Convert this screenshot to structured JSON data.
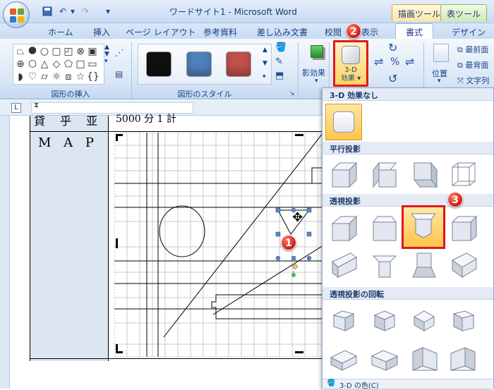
{
  "window": {
    "title": "ワードサイト1 - Microsoft Word",
    "context_tabs": [
      "描画ツール",
      "表ツール"
    ]
  },
  "tabs": [
    "ホーム",
    "挿入",
    "ページ レイアウト",
    "参考資料",
    "差し込み文書",
    "校閲",
    "表示",
    "書式",
    "デザイン"
  ],
  "active_tab": "書式",
  "ribbon": {
    "groups": {
      "insert_shapes": "図形の挿入",
      "shape_styles": "図形のスタイル"
    },
    "shadow_effects": "影効果",
    "three_d": "3-D\n効果",
    "position": "位置",
    "bring_front": "最前面",
    "send_back": "最背面",
    "text_wrap": "文字列"
  },
  "style_colors": [
    "#111111",
    "#4f81bd",
    "#c0504d"
  ],
  "document": {
    "left_text": "M A P",
    "top_text": "貸 乎 亚",
    "top_right": "5000 分 1 計"
  },
  "dropdown": {
    "sections": [
      "3-D 効果なし",
      "平行投影",
      "透視投影",
      "透視投影の回転"
    ],
    "footer": "3-D の色(C)"
  },
  "badges": [
    "1",
    "2",
    "3"
  ]
}
